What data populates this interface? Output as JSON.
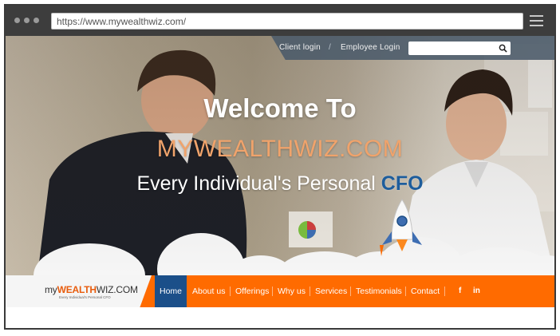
{
  "browser": {
    "url": "https://www.mywealthwiz.com/"
  },
  "header": {
    "client_login": "Client login",
    "separator": "/",
    "employee_login": "Employee Login",
    "search_placeholder": ""
  },
  "hero": {
    "welcome": "Welcome To",
    "brand": "MYWEALTHWIZ.COM",
    "tagline_prefix": "Every Individual's Personal",
    "tagline_highlight": "CFO"
  },
  "logo": {
    "prefix": "my",
    "middle": "WEALTH",
    "suffix": "WIZ.COM",
    "subtitle": "Every Individual's Personal CFO"
  },
  "nav": {
    "items": [
      "Home",
      "About us",
      "Offerings",
      "Why us",
      "Services",
      "Testimonials",
      "Contact"
    ],
    "active": "Home"
  },
  "social": {
    "facebook": "f",
    "linkedin": "in"
  },
  "colors": {
    "accent_orange": "#ff6b00",
    "nav_active": "#1b4f89",
    "brand_orange": "#f0a36b",
    "cfo_blue": "#1e5d9c"
  }
}
